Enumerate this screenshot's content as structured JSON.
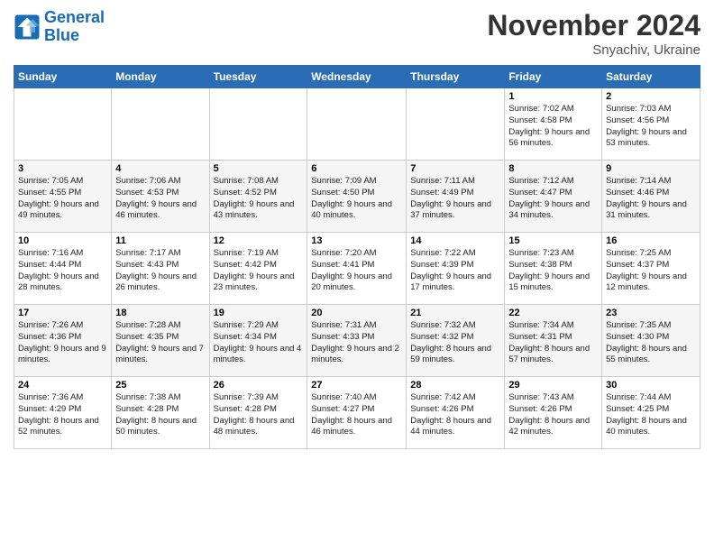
{
  "logo": {
    "line1": "General",
    "line2": "Blue"
  },
  "title": "November 2024",
  "location": "Snyachiv, Ukraine",
  "weekdays": [
    "Sunday",
    "Monday",
    "Tuesday",
    "Wednesday",
    "Thursday",
    "Friday",
    "Saturday"
  ],
  "weeks": [
    [
      {
        "day": "",
        "info": ""
      },
      {
        "day": "",
        "info": ""
      },
      {
        "day": "",
        "info": ""
      },
      {
        "day": "",
        "info": ""
      },
      {
        "day": "",
        "info": ""
      },
      {
        "day": "1",
        "info": "Sunrise: 7:02 AM\nSunset: 4:58 PM\nDaylight: 9 hours and 56 minutes."
      },
      {
        "day": "2",
        "info": "Sunrise: 7:03 AM\nSunset: 4:56 PM\nDaylight: 9 hours and 53 minutes."
      }
    ],
    [
      {
        "day": "3",
        "info": "Sunrise: 7:05 AM\nSunset: 4:55 PM\nDaylight: 9 hours and 49 minutes."
      },
      {
        "day": "4",
        "info": "Sunrise: 7:06 AM\nSunset: 4:53 PM\nDaylight: 9 hours and 46 minutes."
      },
      {
        "day": "5",
        "info": "Sunrise: 7:08 AM\nSunset: 4:52 PM\nDaylight: 9 hours and 43 minutes."
      },
      {
        "day": "6",
        "info": "Sunrise: 7:09 AM\nSunset: 4:50 PM\nDaylight: 9 hours and 40 minutes."
      },
      {
        "day": "7",
        "info": "Sunrise: 7:11 AM\nSunset: 4:49 PM\nDaylight: 9 hours and 37 minutes."
      },
      {
        "day": "8",
        "info": "Sunrise: 7:12 AM\nSunset: 4:47 PM\nDaylight: 9 hours and 34 minutes."
      },
      {
        "day": "9",
        "info": "Sunrise: 7:14 AM\nSunset: 4:46 PM\nDaylight: 9 hours and 31 minutes."
      }
    ],
    [
      {
        "day": "10",
        "info": "Sunrise: 7:16 AM\nSunset: 4:44 PM\nDaylight: 9 hours and 28 minutes."
      },
      {
        "day": "11",
        "info": "Sunrise: 7:17 AM\nSunset: 4:43 PM\nDaylight: 9 hours and 26 minutes."
      },
      {
        "day": "12",
        "info": "Sunrise: 7:19 AM\nSunset: 4:42 PM\nDaylight: 9 hours and 23 minutes."
      },
      {
        "day": "13",
        "info": "Sunrise: 7:20 AM\nSunset: 4:41 PM\nDaylight: 9 hours and 20 minutes."
      },
      {
        "day": "14",
        "info": "Sunrise: 7:22 AM\nSunset: 4:39 PM\nDaylight: 9 hours and 17 minutes."
      },
      {
        "day": "15",
        "info": "Sunrise: 7:23 AM\nSunset: 4:38 PM\nDaylight: 9 hours and 15 minutes."
      },
      {
        "day": "16",
        "info": "Sunrise: 7:25 AM\nSunset: 4:37 PM\nDaylight: 9 hours and 12 minutes."
      }
    ],
    [
      {
        "day": "17",
        "info": "Sunrise: 7:26 AM\nSunset: 4:36 PM\nDaylight: 9 hours and 9 minutes."
      },
      {
        "day": "18",
        "info": "Sunrise: 7:28 AM\nSunset: 4:35 PM\nDaylight: 9 hours and 7 minutes."
      },
      {
        "day": "19",
        "info": "Sunrise: 7:29 AM\nSunset: 4:34 PM\nDaylight: 9 hours and 4 minutes."
      },
      {
        "day": "20",
        "info": "Sunrise: 7:31 AM\nSunset: 4:33 PM\nDaylight: 9 hours and 2 minutes."
      },
      {
        "day": "21",
        "info": "Sunrise: 7:32 AM\nSunset: 4:32 PM\nDaylight: 8 hours and 59 minutes."
      },
      {
        "day": "22",
        "info": "Sunrise: 7:34 AM\nSunset: 4:31 PM\nDaylight: 8 hours and 57 minutes."
      },
      {
        "day": "23",
        "info": "Sunrise: 7:35 AM\nSunset: 4:30 PM\nDaylight: 8 hours and 55 minutes."
      }
    ],
    [
      {
        "day": "24",
        "info": "Sunrise: 7:36 AM\nSunset: 4:29 PM\nDaylight: 8 hours and 52 minutes."
      },
      {
        "day": "25",
        "info": "Sunrise: 7:38 AM\nSunset: 4:28 PM\nDaylight: 8 hours and 50 minutes."
      },
      {
        "day": "26",
        "info": "Sunrise: 7:39 AM\nSunset: 4:28 PM\nDaylight: 8 hours and 48 minutes."
      },
      {
        "day": "27",
        "info": "Sunrise: 7:40 AM\nSunset: 4:27 PM\nDaylight: 8 hours and 46 minutes."
      },
      {
        "day": "28",
        "info": "Sunrise: 7:42 AM\nSunset: 4:26 PM\nDaylight: 8 hours and 44 minutes."
      },
      {
        "day": "29",
        "info": "Sunrise: 7:43 AM\nSunset: 4:26 PM\nDaylight: 8 hours and 42 minutes."
      },
      {
        "day": "30",
        "info": "Sunrise: 7:44 AM\nSunset: 4:25 PM\nDaylight: 8 hours and 40 minutes."
      }
    ]
  ]
}
